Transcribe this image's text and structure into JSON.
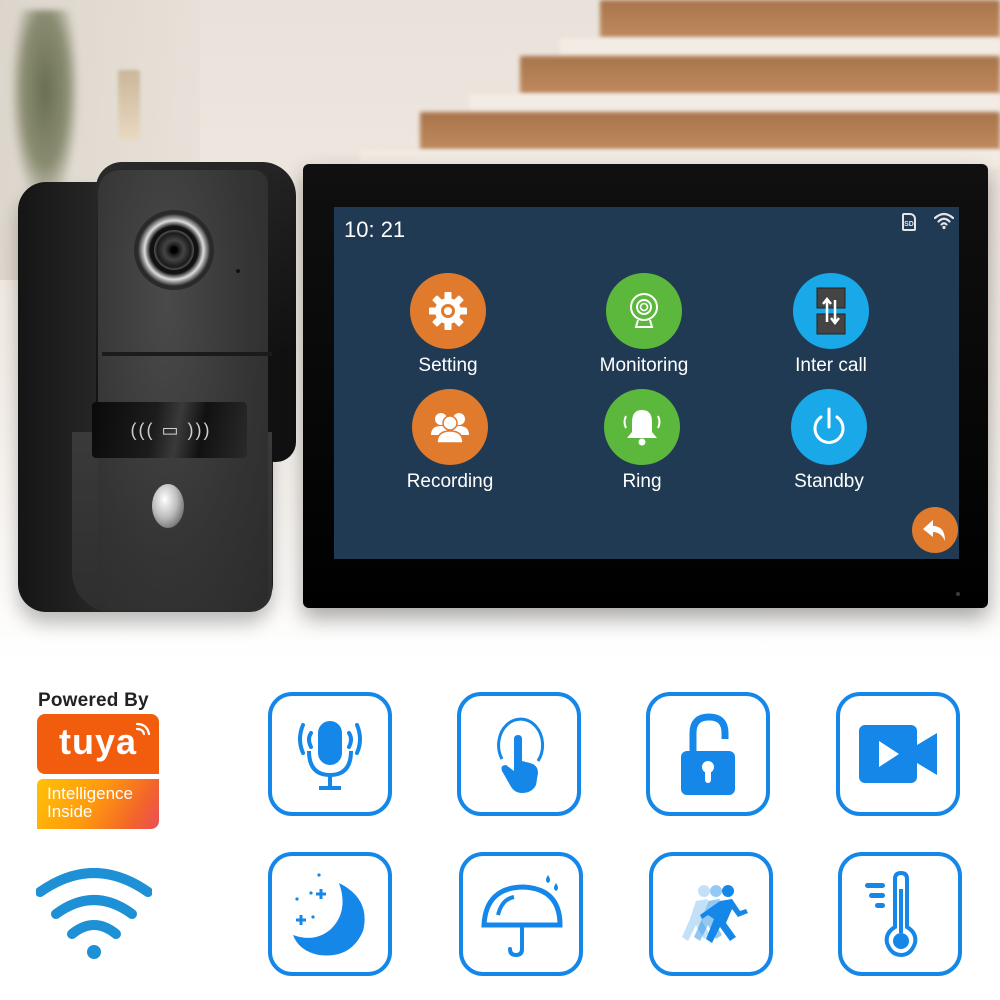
{
  "monitor": {
    "status_bar": {
      "time": "10: 21",
      "sd_card_icon": "sd-card-icon",
      "sd_label": "SD",
      "wifi_icon": "wifi-icon"
    },
    "menu": [
      {
        "label": "Setting",
        "icon": "gear-icon",
        "color": "#e07b2e"
      },
      {
        "label": "Monitoring",
        "icon": "webcam-icon",
        "color": "#5cb83c"
      },
      {
        "label": "Inter call",
        "icon": "inter-call-icon",
        "color": "#1aa9e8"
      },
      {
        "label": "Recording",
        "icon": "group-icon",
        "color": "#e07b2e"
      },
      {
        "label": "Ring",
        "icon": "bell-icon",
        "color": "#5cb83c"
      },
      {
        "label": "Standby",
        "icon": "power-icon",
        "color": "#1aa9e8"
      }
    ],
    "back_icon": "back-arrow-icon",
    "back_color": "#e07b2e",
    "screen_color": "#1f3a52"
  },
  "doorbell": {
    "rfid_glyph": "((( ▭ )))",
    "button_glyph": "🔔"
  },
  "branding": {
    "powered_by": "Powered By",
    "brand": "tuya",
    "tagline_line1": "Intelligence",
    "tagline_line2": "Inside",
    "brand_color": "#f25d0d"
  },
  "features": [
    {
      "icon": "microphone-icon"
    },
    {
      "icon": "touch-icon"
    },
    {
      "icon": "unlock-icon"
    },
    {
      "icon": "video-camera-icon"
    },
    {
      "icon": "night-vision-icon"
    },
    {
      "icon": "waterproof-umbrella-icon"
    },
    {
      "icon": "motion-detection-icon"
    },
    {
      "icon": "temperature-icon"
    }
  ],
  "feature_color": "#1487e8",
  "wifi_color": "#1e90d6"
}
